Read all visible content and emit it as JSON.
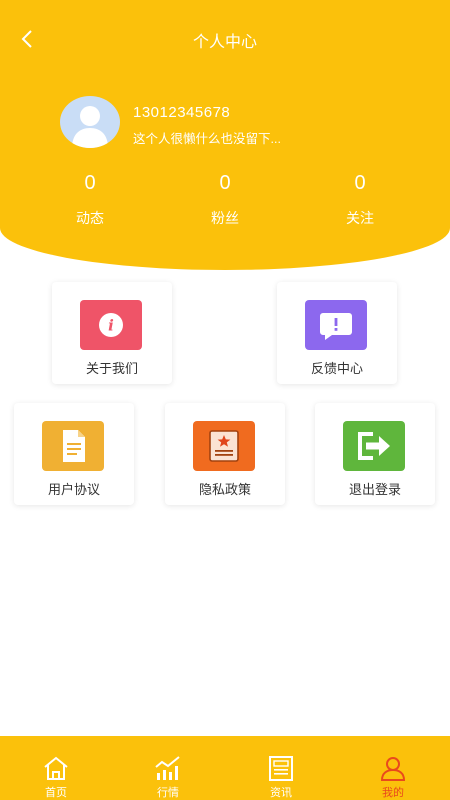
{
  "header": {
    "title": "个人中心",
    "back_icon": "chevron-left-icon"
  },
  "profile": {
    "phone": "13012345678",
    "bio": "这个人很懒什么也没留下..."
  },
  "stats": [
    {
      "value": "0",
      "label": "动态"
    },
    {
      "value": "0",
      "label": "粉丝"
    },
    {
      "value": "0",
      "label": "关注"
    }
  ],
  "menu": {
    "about": {
      "label": "关于我们",
      "icon": "info-icon",
      "color": "#EF5468"
    },
    "feedback": {
      "label": "反馈中心",
      "icon": "chat-alert-icon",
      "color": "#8C68EE"
    },
    "agreement": {
      "label": "用户协议",
      "icon": "document-icon",
      "color": "#F0B033"
    },
    "privacy": {
      "label": "隐私政策",
      "icon": "policy-doc-icon",
      "color": "#F06B1F"
    },
    "logout": {
      "label": "退出登录",
      "icon": "exit-icon",
      "color": "#5FB63C"
    }
  },
  "tabbar": {
    "items": [
      {
        "label": "首页",
        "icon": "home-icon"
      },
      {
        "label": "行情",
        "icon": "chart-trend-icon"
      },
      {
        "label": "资讯",
        "icon": "news-icon"
      },
      {
        "label": "我的",
        "icon": "user-icon"
      }
    ],
    "active_color": "#E94A1C"
  },
  "colors": {
    "brand": "#FBC10B"
  }
}
